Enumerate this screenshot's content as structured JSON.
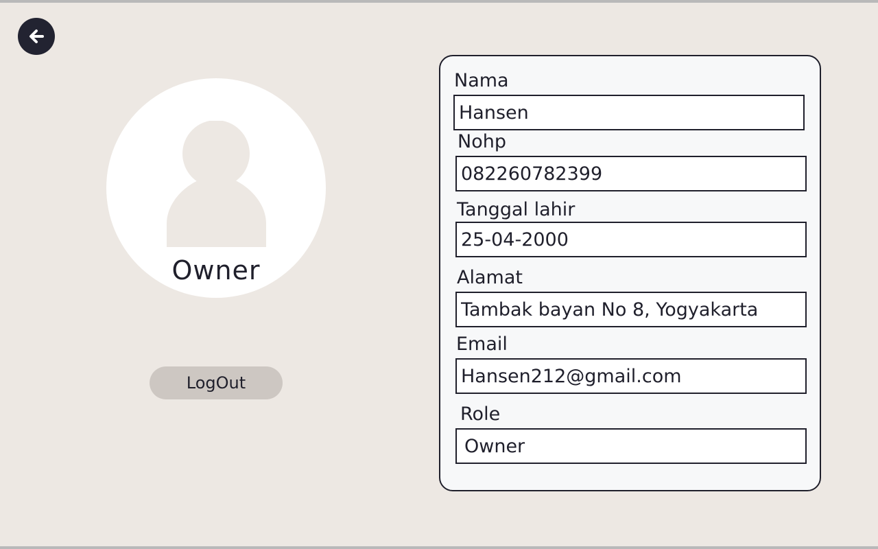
{
  "profile": {
    "role_label": "Owner",
    "logout_label": "LogOut"
  },
  "icons": {
    "back": "arrow-left-icon",
    "avatar": "user-silhouette-icon"
  },
  "colors": {
    "background": "#ede8e3",
    "dark": "#222331",
    "logout_button": "#cdc7c2",
    "card": "#f7f8f9",
    "avatar_circle": "#ffffff",
    "avatar_figure": "#ede8e3"
  },
  "form": {
    "nama": {
      "label": "Nama",
      "value": "Hansen"
    },
    "nohp": {
      "label": "Nohp",
      "value": "082260782399"
    },
    "tanggal_lahir": {
      "label": "Tanggal lahir",
      "value": "25-04-2000"
    },
    "alamat": {
      "label": "Alamat",
      "value": "Tambak bayan No 8, Yogyakarta"
    },
    "email": {
      "label": "Email",
      "value": "Hansen212@gmail.com"
    },
    "role": {
      "label": "Role",
      "value": "Owner"
    }
  }
}
